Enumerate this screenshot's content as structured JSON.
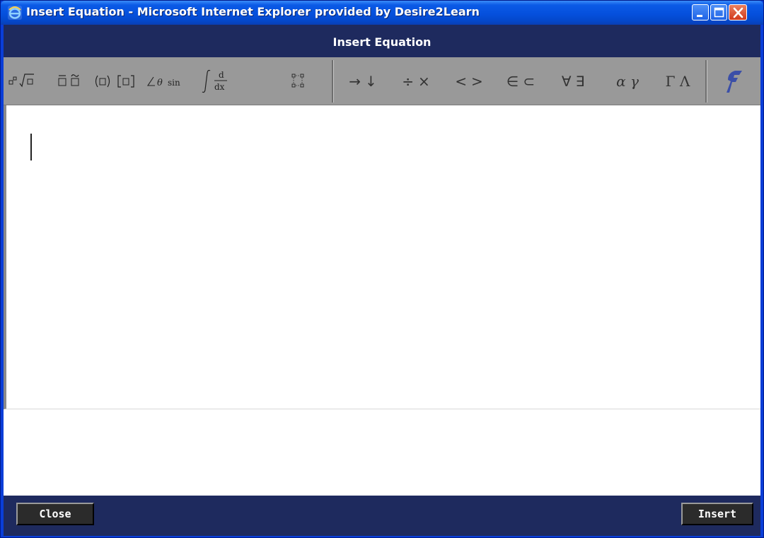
{
  "window": {
    "title": "Insert Equation - Microsoft Internet Explorer provided by Desire2Learn"
  },
  "dialog": {
    "header": "Insert Equation"
  },
  "toolbar": {
    "groups": [
      {
        "name": "scripts-and-radicals"
      },
      {
        "name": "accents"
      },
      {
        "name": "brackets"
      },
      {
        "name": "functions"
      },
      {
        "name": "calculus"
      },
      {
        "name": "matrices"
      }
    ],
    "symbols": {
      "arrows": "→↓",
      "operators": "÷×",
      "relations": "<>",
      "sets": "∈⊂",
      "logic": "∀∃",
      "greek_lower": "α γ",
      "greek_upper": "Γ Λ"
    },
    "functions_label": "sin"
  },
  "footer": {
    "close_label": "Close",
    "insert_label": "Insert"
  },
  "colors": {
    "header_bg": "#1e2a5e",
    "toolbar_bg": "#999999",
    "wrench": "#3b4fa8"
  },
  "icons": [
    "ie-icon",
    "minimize-icon",
    "maximize-icon",
    "close-icon",
    "wrench-icon"
  ]
}
